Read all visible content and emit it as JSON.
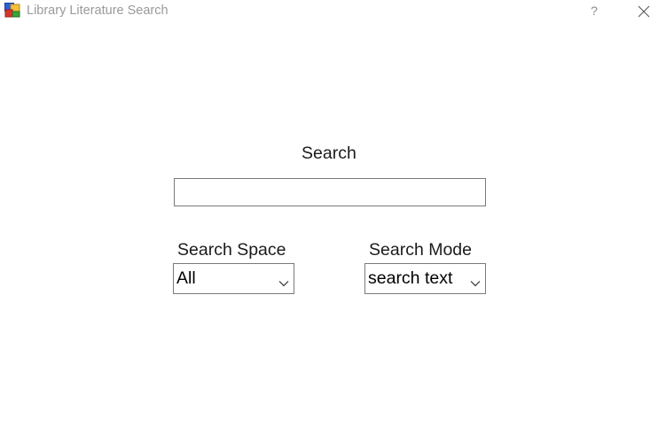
{
  "window": {
    "title": "Library Literature Search",
    "help_glyph": "?",
    "icons": {
      "app": "app-icon",
      "help": "help-icon",
      "close": "close-icon"
    }
  },
  "form": {
    "search_label": "Search",
    "search_value": "",
    "search_space": {
      "label": "Search Space",
      "selected": "All"
    },
    "search_mode": {
      "label": "Search Mode",
      "selected": "search text"
    }
  },
  "colors": {
    "title_text": "#9a9a9a",
    "border": "#7a7a7a",
    "text": "#1a1a1a"
  }
}
